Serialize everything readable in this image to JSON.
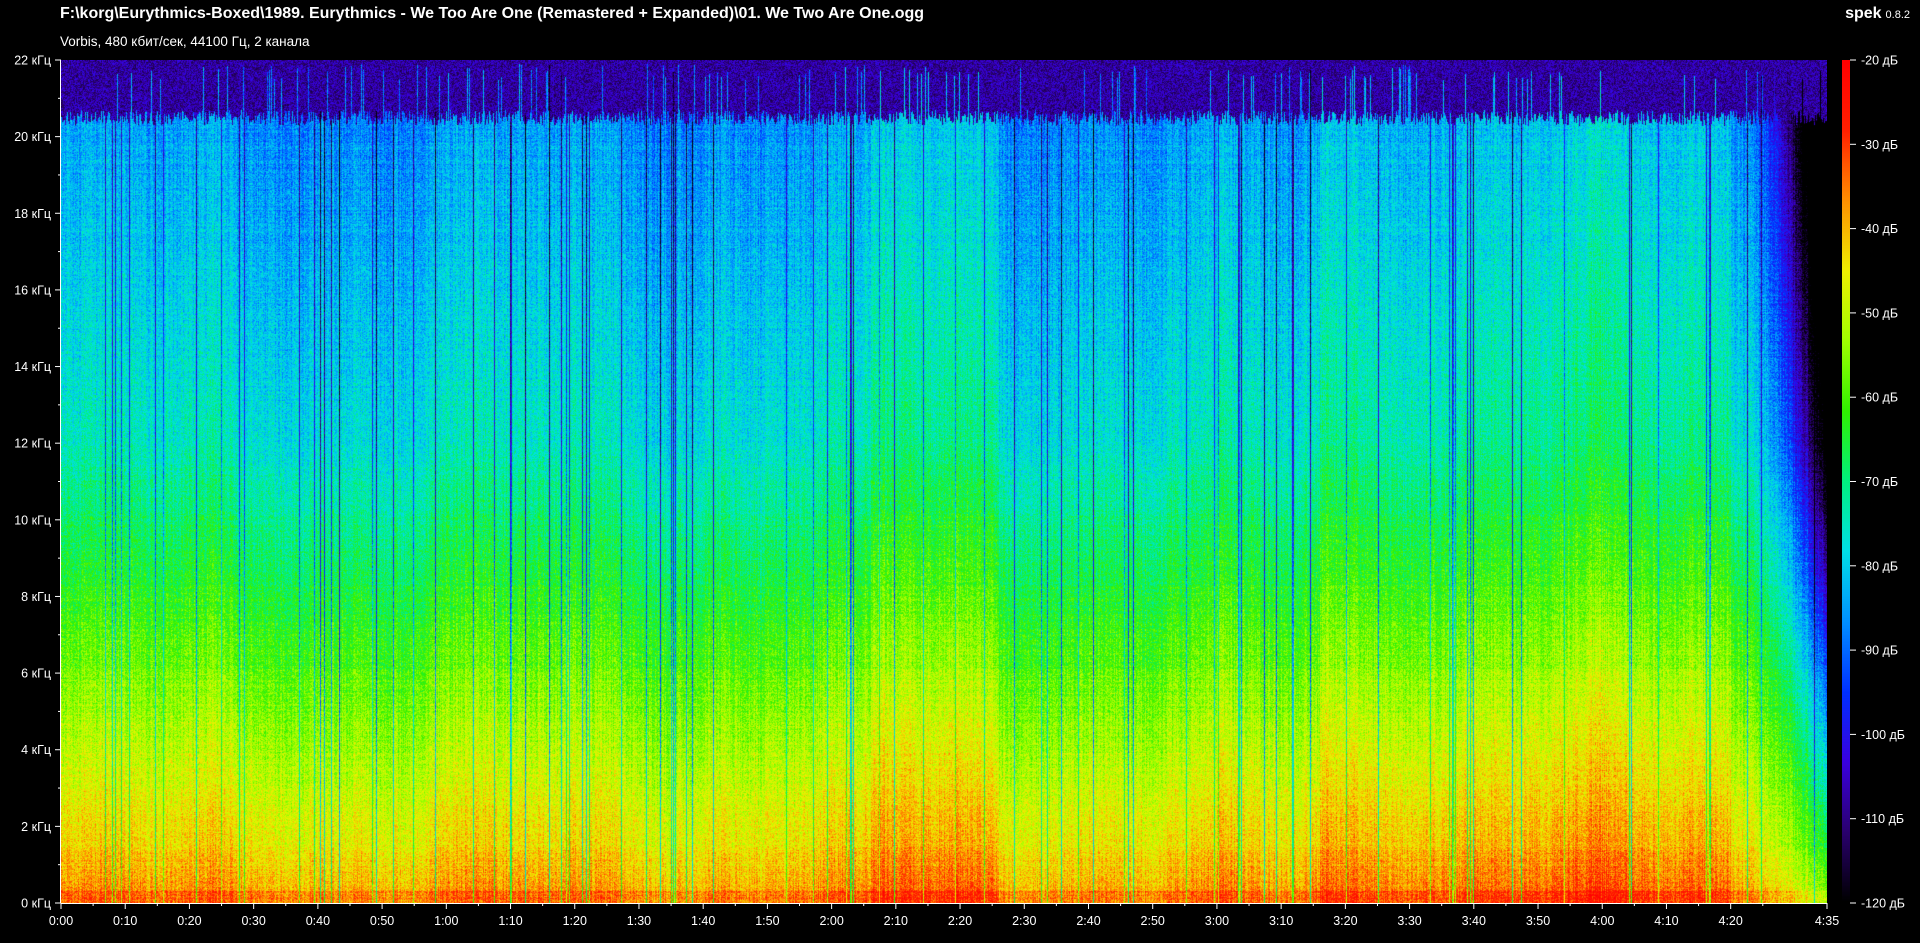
{
  "header": {
    "file_path": "F:\\korg\\Eurythmics-Boxed\\1989. Eurythmics - We Too Are One (Remastered + Expanded)\\01. We Two Are One.ogg",
    "file_info": "Vorbis, 480 кбит/сек, 44100 Гц, 2 канала",
    "app_name": "spek",
    "app_version": "0.8.2"
  },
  "spectrogram": {
    "freq_axis": {
      "ticks": [
        "0 кГц",
        "2 кГц",
        "4 кГц",
        "6 кГц",
        "8 кГц",
        "10 кГц",
        "12 кГц",
        "14 кГц",
        "16 кГц",
        "18 кГц",
        "20 кГц",
        "22 кГц"
      ],
      "range_khz": [
        0,
        22
      ]
    },
    "time_axis": {
      "ticks": [
        "0:00",
        "0:10",
        "0:20",
        "0:30",
        "0:40",
        "0:50",
        "1:00",
        "1:10",
        "1:20",
        "1:30",
        "1:40",
        "1:50",
        "2:00",
        "2:10",
        "2:20",
        "2:30",
        "2:40",
        "2:50",
        "3:00",
        "3:10",
        "3:20",
        "3:30",
        "3:40",
        "3:50",
        "4:00",
        "4:10",
        "4:20",
        "4:35"
      ],
      "duration_seconds": 275
    },
    "db_scale": {
      "ticks": [
        "-20 дБ",
        "-30 дБ",
        "-40 дБ",
        "-50 дБ",
        "-60 дБ",
        "-70 дБ",
        "-80 дБ",
        "-90 дБ",
        "-100 дБ",
        "-110 дБ",
        "-120 дБ"
      ],
      "range_db": [
        -120,
        -20
      ]
    },
    "palette": [
      "#000000",
      "#2a006e",
      "#3a00e0",
      "#0030ff",
      "#0090ff",
      "#00e0e8",
      "#00f080",
      "#30f000",
      "#a0ff00",
      "#f0f000",
      "#ff9000",
      "#ff2000",
      "#ff0000"
    ]
  }
}
